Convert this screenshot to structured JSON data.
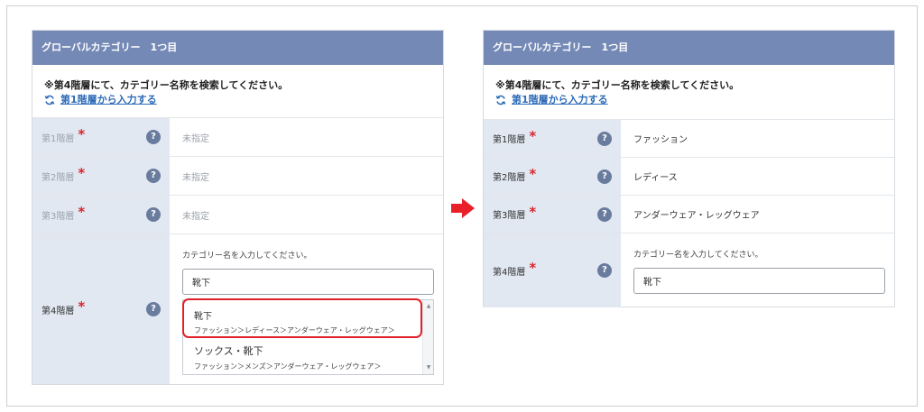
{
  "left": {
    "header": "グローバルカテゴリー　1つ目",
    "notice": "※第4階層にて、カテゴリー名称を検索してください。",
    "reset_link": "第1階層から入力する",
    "rows": [
      {
        "label": "第1階層",
        "required": "*",
        "help": "?",
        "value": "未指定"
      },
      {
        "label": "第2階層",
        "required": "*",
        "help": "?",
        "value": "未指定"
      },
      {
        "label": "第3階層",
        "required": "*",
        "help": "?",
        "value": "未指定"
      },
      {
        "label": "第4階層",
        "required": "*",
        "help": "?"
      }
    ],
    "input_hint": "カテゴリー名を入力してください。",
    "input_value": "靴下",
    "suggestions": [
      {
        "name": "靴下",
        "path": "ファッション＞レディース＞アンダーウェア・レッグウェア＞"
      },
      {
        "name": "ソックス・靴下",
        "path": "ファッション＞メンズ＞アンダーウェア・レッグウェア＞"
      }
    ]
  },
  "right": {
    "header": "グローバルカテゴリー　1つ目",
    "notice": "※第4階層にて、カテゴリー名称を検索してください。",
    "reset_link": "第1階層から入力する",
    "rows": [
      {
        "label": "第1階層",
        "required": "*",
        "help": "?",
        "value": "ファッション"
      },
      {
        "label": "第2階層",
        "required": "*",
        "help": "?",
        "value": "レディース"
      },
      {
        "label": "第3階層",
        "required": "*",
        "help": "?",
        "value": "アンダーウェア・レッグウェア"
      },
      {
        "label": "第4階層",
        "required": "*",
        "help": "?"
      }
    ],
    "input_hint": "カテゴリー名を入力してください。",
    "input_value": "靴下"
  },
  "colors": {
    "header_bg": "#7489b5",
    "label_bg": "#e1e8f2",
    "required": "#d8262c",
    "link": "#2f6cb8",
    "highlight": "#e0202a",
    "arrow": "#e8202a"
  },
  "icons": {
    "reset": "refresh-icon",
    "help": "question-circle-icon",
    "arrow": "arrow-right-icon",
    "scroll_up": "chevron-up-icon",
    "scroll_down": "chevron-down-icon"
  }
}
